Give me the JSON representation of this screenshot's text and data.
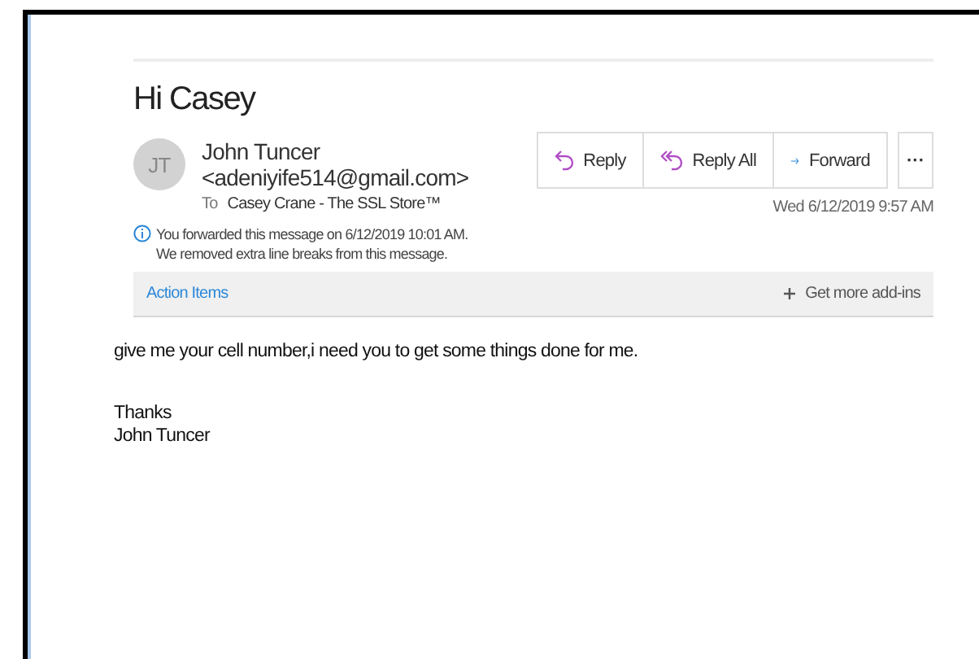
{
  "subject": "Hi Casey",
  "sender": {
    "initials": "JT",
    "name": "John Tuncer <adeniyife514@gmail.com>",
    "to_label": "To",
    "to": "Casey Crane - The SSL Store™"
  },
  "actions": [
    {
      "kind": "reply",
      "label": "Reply"
    },
    {
      "kind": "reply_all",
      "label": "Reply All"
    },
    {
      "kind": "forward",
      "label": "Forward"
    },
    {
      "kind": "more",
      "label": "···"
    }
  ],
  "date": "Wed 6/12/2019 9:57 AM",
  "notices": [
    "You forwarded this message on 6/12/2019 10:01 AM.",
    "We removed extra line breaks from this message."
  ],
  "addins_bar": {
    "label": "Action Items",
    "action": "Get more add-ins"
  },
  "body": [
    "give me your cell number,i need you to get some things done for me.",
    "Thanks",
    "John Tuncer"
  ]
}
